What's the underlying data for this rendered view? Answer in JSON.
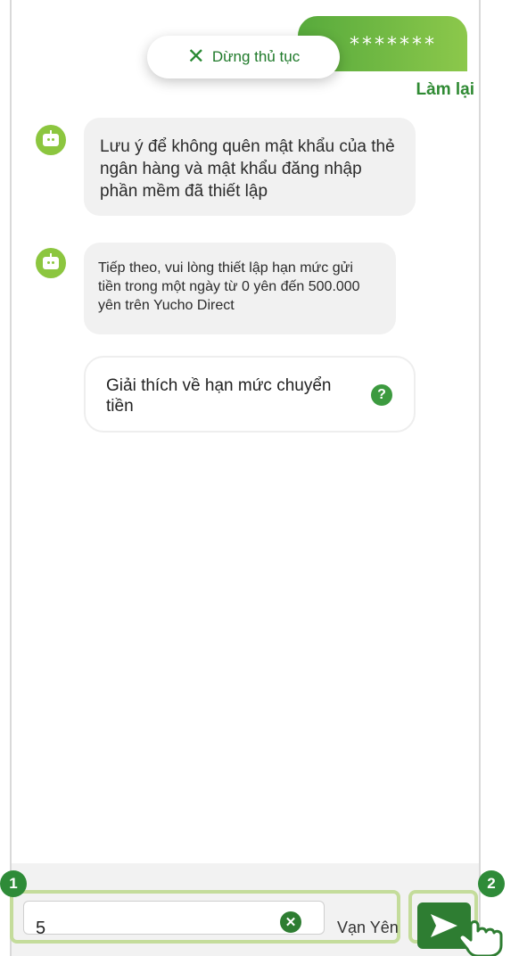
{
  "header": {
    "user_message_masked": "*******",
    "stop_label": "Dừng thủ tục",
    "redo_label": "Làm lại"
  },
  "messages": [
    {
      "text": "Lưu ý để không quên mật khẩu của thẻ ngân hàng và mật khẩu đăng nhập phần mềm đã thiết lập"
    },
    {
      "text": "Tiếp theo, vui lòng thiết lập hạn mức gửi tiền trong một ngày từ 0 yên đến 500.000 yên trên Yucho Direct"
    }
  ],
  "help_card": {
    "label": "Giải thích về hạn mức chuyển tiền",
    "icon": "help-icon",
    "icon_glyph": "?"
  },
  "input": {
    "value": "5",
    "unit": "Vạn Yên",
    "clear_icon": "clear-icon"
  },
  "send_button": {
    "icon": "send-icon"
  },
  "badges": {
    "input_step": "1",
    "send_step": "2"
  },
  "colors": {
    "accent": "#2e7d32",
    "bot_icon": "#8cc63f",
    "user_bubble": "#6cb63f",
    "highlight": "#c4dc9b"
  }
}
